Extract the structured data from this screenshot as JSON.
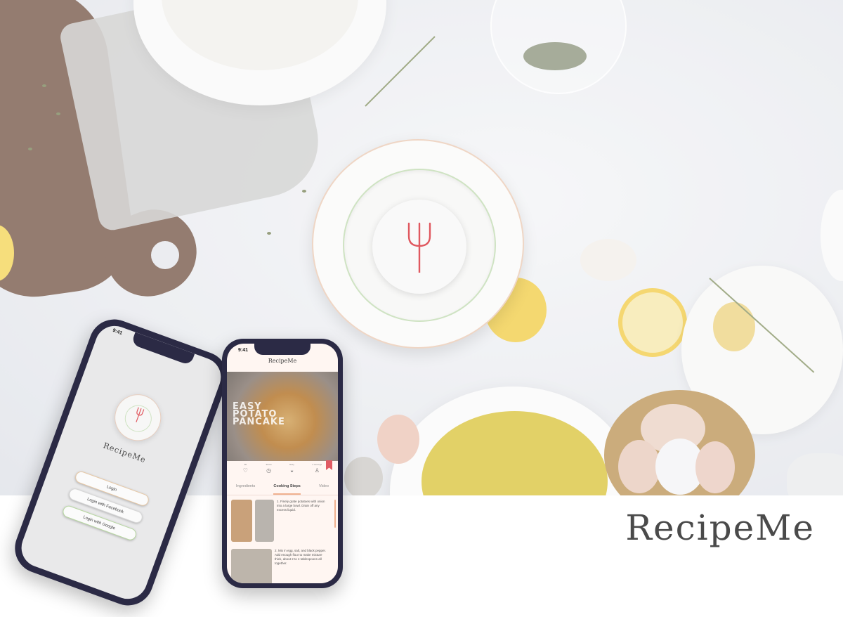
{
  "brand": {
    "name": "RecipeMe"
  },
  "phone_login": {
    "status_time": "9:41",
    "app_name": "RecipeMe",
    "buttons": {
      "login": "Login",
      "facebook": "Login with Facebook",
      "google": "Login with Google"
    }
  },
  "phone_recipe": {
    "status_time": "9:41",
    "app_name": "RecipeMe",
    "hero_title_lines": [
      "EASY",
      "POTATO",
      "PANCAKE"
    ],
    "info_icons": [
      {
        "label": "85",
        "icon": "heart-icon",
        "glyph": "♡"
      },
      {
        "label": "30min",
        "icon": "clock-icon",
        "glyph": "◷"
      },
      {
        "label": "Easy",
        "icon": "pot-icon",
        "glyph": "◒"
      },
      {
        "label": "2 servings",
        "icon": "person-icon",
        "glyph": "♙"
      }
    ],
    "tabs": {
      "ingredients": "Ingredients",
      "steps": "Cooking Steps",
      "video": "Video"
    },
    "steps": [
      "1. Finely grate potatoes with onion into a large bowl. Drain off any excess liquid.",
      "2. Mix in egg, salt, and black pepper. Add enough flour to make mixture thick, about 2 to 4 tablespoons all together."
    ]
  },
  "colors": {
    "fork_red": "#e0585f",
    "plate_outline": "#efd6c5",
    "ring_green": "#cfe3c3",
    "phone_frame": "#2b2a45",
    "brand_text": "#4a4a4a"
  }
}
